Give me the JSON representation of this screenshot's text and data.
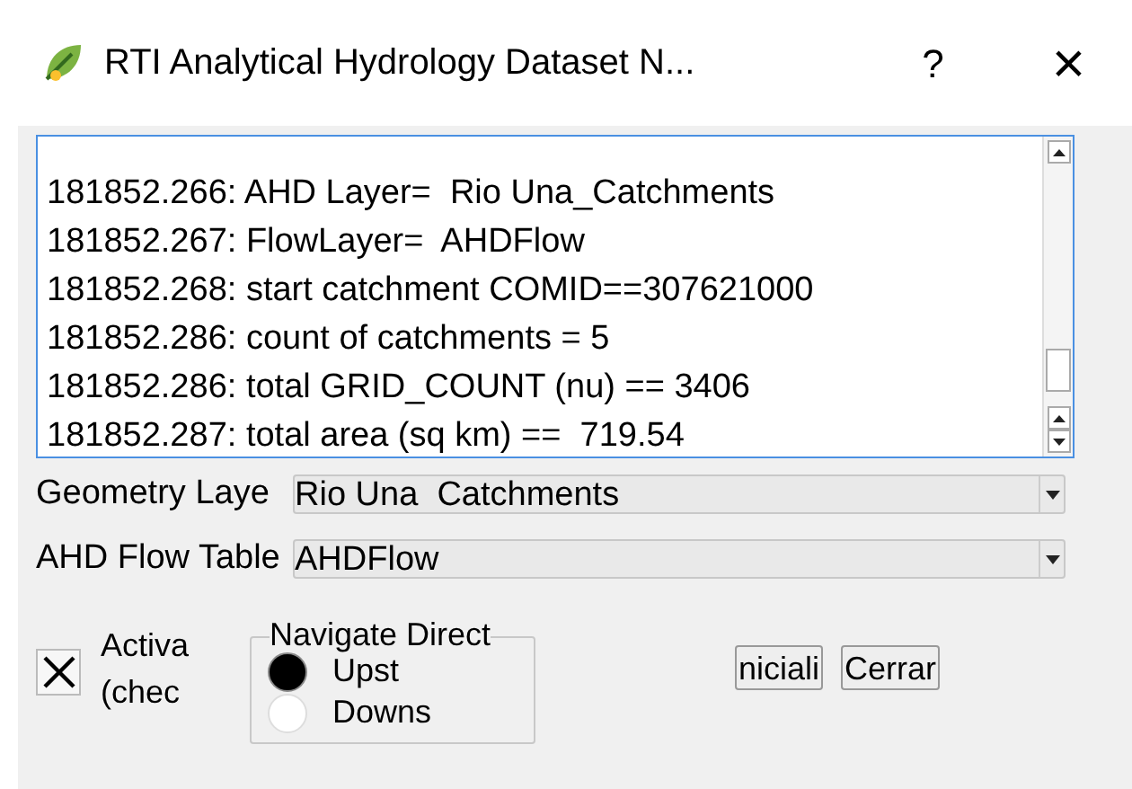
{
  "window": {
    "title": "RTI Analytical Hydrology Dataset N...",
    "help": "?",
    "close": "×"
  },
  "log": {
    "lines": [
      "181852.266: AHD Layer=  Rio Una_Catchments",
      "181852.267: FlowLayer=  AHDFlow",
      "181852.268: start catchment COMID==307621000",
      "181852.286: count of catchments = 5",
      "181852.286: total GRID_COUNT (nu) == 3406",
      "181852.287: total area (sq km) ==  719.54"
    ]
  },
  "fields": [
    {
      "label": "Geometry Laye",
      "value": "Rio Una  Catchments"
    },
    {
      "label": "AHD Flow Table",
      "value": "AHDFlow"
    }
  ],
  "checkbox": {
    "lines": [
      "Activa",
      "(chec"
    ],
    "checked": true
  },
  "navigate": {
    "title": "Navigate Direct",
    "options": [
      {
        "label": "Upst",
        "selected": true
      },
      {
        "label": "Downs",
        "selected": false
      }
    ]
  },
  "buttons": [
    "niciali",
    "Cerrar"
  ]
}
